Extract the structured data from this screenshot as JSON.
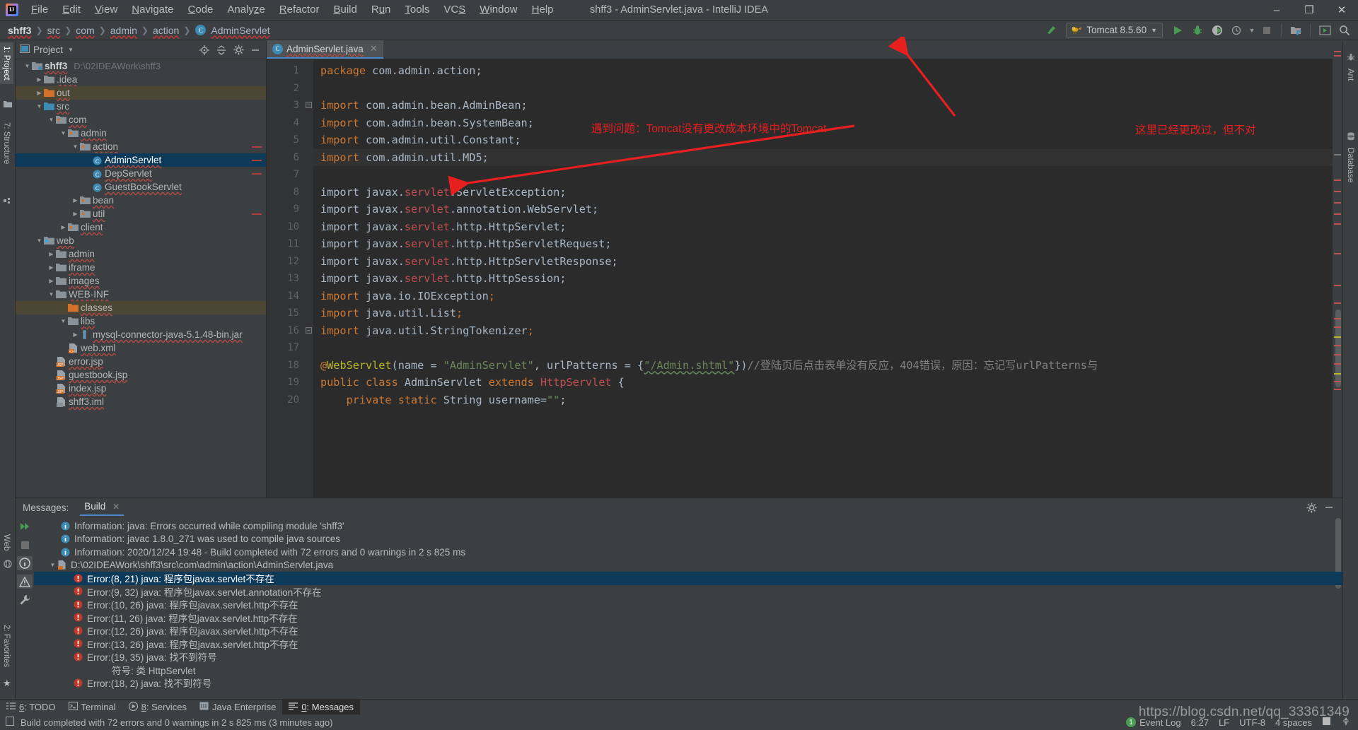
{
  "window": {
    "title": "shff3 - AdminServlet.java - IntelliJ IDEA",
    "minimize": "–",
    "maximize": "❐",
    "close": "✕"
  },
  "menu": [
    {
      "label": "File",
      "mnemonic": "F"
    },
    {
      "label": "Edit",
      "mnemonic": "E"
    },
    {
      "label": "View",
      "mnemonic": "V"
    },
    {
      "label": "Navigate",
      "mnemonic": "N"
    },
    {
      "label": "Code",
      "mnemonic": "C"
    },
    {
      "label": "Analyze",
      "mnemonic": "z"
    },
    {
      "label": "Refactor",
      "mnemonic": "R"
    },
    {
      "label": "Build",
      "mnemonic": "B"
    },
    {
      "label": "Run",
      "mnemonic": "u"
    },
    {
      "label": "Tools",
      "mnemonic": "T"
    },
    {
      "label": "VCS",
      "mnemonic": "S"
    },
    {
      "label": "Window",
      "mnemonic": "W"
    },
    {
      "label": "Help",
      "mnemonic": "H"
    }
  ],
  "breadcrumb": [
    "shff3",
    "src",
    "com",
    "admin",
    "action",
    "AdminServlet"
  ],
  "toolbar": {
    "run_config": "Tomcat 8.5.60",
    "run_icon": "run-icon",
    "debug_icon": "debug-icon",
    "coverage_icon": "coverage-icon",
    "profile_icon": "profile-icon",
    "stop_icon": "stop-icon",
    "update_icon": "update-app-icon",
    "browser_icon": "open-browser-icon",
    "search_icon": "search-everywhere-icon",
    "build_icon": "make-project-icon"
  },
  "left_tabs": [
    {
      "label": "1: Project",
      "mnemonic": "1",
      "selected": true,
      "icon": "project-icon"
    },
    {
      "label": "7: Structure",
      "mnemonic": "7",
      "selected": false,
      "icon": "structure-icon"
    },
    {
      "label": "Web",
      "selected": false,
      "icon": "web-icon"
    },
    {
      "label": "2: Favorites",
      "mnemonic": "2",
      "selected": false,
      "icon": "star-icon"
    }
  ],
  "right_tabs": [
    {
      "label": "Ant",
      "icon": "ant-icon"
    },
    {
      "label": "Database",
      "icon": "database-icon"
    }
  ],
  "project_panel": {
    "title": "Project",
    "actions": [
      "locate-icon",
      "collapse-all-icon",
      "settings-icon",
      "hide-icon"
    ],
    "tree": [
      {
        "depth": 0,
        "label": "shff3",
        "path": "D:\\02IDEAWork\\shff3",
        "icon": "module-folder",
        "arrow": "down",
        "bold": true,
        "state": "normal",
        "tick": false
      },
      {
        "depth": 1,
        "label": ".idea",
        "icon": "folder",
        "arrow": "right",
        "state": "normal",
        "tick": false
      },
      {
        "depth": 1,
        "label": "out",
        "icon": "folder-orange",
        "arrow": "right",
        "state": "amber",
        "tick": false
      },
      {
        "depth": 1,
        "label": "src",
        "icon": "folder-blue",
        "arrow": "down",
        "state": "normal",
        "tick": false
      },
      {
        "depth": 2,
        "label": "com",
        "icon": "package",
        "arrow": "down",
        "state": "normal",
        "tick": false
      },
      {
        "depth": 3,
        "label": "admin",
        "icon": "package",
        "arrow": "down",
        "state": "normal",
        "tick": false
      },
      {
        "depth": 4,
        "label": "action",
        "icon": "package",
        "arrow": "down",
        "state": "normal",
        "tick": true
      },
      {
        "depth": 5,
        "label": "AdminServlet",
        "icon": "java-class",
        "arrow": "none",
        "state": "selected",
        "tick": true
      },
      {
        "depth": 5,
        "label": "DepServlet",
        "icon": "java-class",
        "arrow": "none",
        "state": "normal",
        "tick": true
      },
      {
        "depth": 5,
        "label": "GuestBookServlet",
        "icon": "java-class",
        "arrow": "none",
        "state": "normal",
        "tick": false
      },
      {
        "depth": 4,
        "label": "bean",
        "icon": "package",
        "arrow": "right",
        "state": "normal",
        "tick": false
      },
      {
        "depth": 4,
        "label": "util",
        "icon": "package",
        "arrow": "right",
        "state": "normal",
        "tick": true
      },
      {
        "depth": 3,
        "label": "client",
        "icon": "package",
        "arrow": "right",
        "state": "normal",
        "tick": false
      },
      {
        "depth": 1,
        "label": "web",
        "icon": "web-folder",
        "arrow": "down",
        "state": "normal",
        "tick": false
      },
      {
        "depth": 2,
        "label": "admin",
        "icon": "folder",
        "arrow": "right",
        "state": "normal",
        "tick": false
      },
      {
        "depth": 2,
        "label": "iframe",
        "icon": "folder",
        "arrow": "right",
        "state": "normal",
        "tick": false
      },
      {
        "depth": 2,
        "label": "images",
        "icon": "folder",
        "arrow": "right",
        "state": "normal",
        "tick": false
      },
      {
        "depth": 2,
        "label": "WEB-INF",
        "icon": "folder",
        "arrow": "down",
        "state": "normal",
        "tick": false
      },
      {
        "depth": 3,
        "label": "classes",
        "icon": "folder-orange",
        "arrow": "none",
        "state": "amber",
        "tick": false
      },
      {
        "depth": 3,
        "label": "libs",
        "icon": "folder",
        "arrow": "down",
        "state": "normal",
        "tick": false
      },
      {
        "depth": 4,
        "label": "mysql-connector-java-5.1.48-bin.jar",
        "icon": "jar",
        "arrow": "right",
        "state": "normal",
        "tick": false
      },
      {
        "depth": 3,
        "label": "web.xml",
        "icon": "xml-file",
        "arrow": "none",
        "state": "normal",
        "tick": false
      },
      {
        "depth": 2,
        "label": "error.jsp",
        "icon": "jsp-file",
        "arrow": "none",
        "state": "normal",
        "tick": false
      },
      {
        "depth": 2,
        "label": "guestbook.jsp",
        "icon": "jsp-file",
        "arrow": "none",
        "state": "normal",
        "tick": false
      },
      {
        "depth": 2,
        "label": "index.jsp",
        "icon": "jsp-file",
        "arrow": "none",
        "state": "normal",
        "tick": false
      },
      {
        "depth": 2,
        "label": "shff3.iml",
        "icon": "iml-file",
        "arrow": "none",
        "state": "normal",
        "tick": false
      }
    ]
  },
  "editor": {
    "tab": {
      "label": "AdminServlet.java",
      "icon": "java-class",
      "close": "✕"
    },
    "lines": [
      {
        "n": 1,
        "tokens": [
          {
            "t": "package ",
            "c": "kw"
          },
          {
            "t": "com.admin.action;",
            "c": ""
          }
        ]
      },
      {
        "n": 2,
        "tokens": []
      },
      {
        "n": 3,
        "fold": true,
        "tokens": [
          {
            "t": "import ",
            "c": "kw"
          },
          {
            "t": "com.admin.bean.AdminBean;",
            "c": ""
          }
        ]
      },
      {
        "n": 4,
        "tokens": [
          {
            "t": "import ",
            "c": "kw"
          },
          {
            "t": "com.admin.bean.SystemBean;",
            "c": ""
          }
        ]
      },
      {
        "n": 5,
        "tokens": [
          {
            "t": "import ",
            "c": "kw"
          },
          {
            "t": "com.admin.util.Constant;",
            "c": ""
          }
        ]
      },
      {
        "n": 6,
        "hl": true,
        "tokens": [
          {
            "t": "import ",
            "c": "kw"
          },
          {
            "t": "com.admin.util.MD5;",
            "c": ""
          }
        ]
      },
      {
        "n": 7,
        "tokens": []
      },
      {
        "n": 8,
        "tokens": [
          {
            "t": "import javax.",
            "c": ""
          },
          {
            "t": "servlet",
            "c": "err"
          },
          {
            "t": ".ServletException;",
            "c": ""
          }
        ]
      },
      {
        "n": 9,
        "tokens": [
          {
            "t": "import javax.",
            "c": ""
          },
          {
            "t": "servlet",
            "c": "err"
          },
          {
            "t": ".annotation.WebServlet;",
            "c": ""
          }
        ]
      },
      {
        "n": 10,
        "tokens": [
          {
            "t": "import javax.",
            "c": ""
          },
          {
            "t": "servlet",
            "c": "err"
          },
          {
            "t": ".http.HttpServlet;",
            "c": ""
          }
        ]
      },
      {
        "n": 11,
        "tokens": [
          {
            "t": "import javax.",
            "c": ""
          },
          {
            "t": "servlet",
            "c": "err"
          },
          {
            "t": ".http.HttpServletRequest;",
            "c": ""
          }
        ]
      },
      {
        "n": 12,
        "tokens": [
          {
            "t": "import javax.",
            "c": ""
          },
          {
            "t": "servlet",
            "c": "err"
          },
          {
            "t": ".http.HttpServletResponse;",
            "c": ""
          }
        ]
      },
      {
        "n": 13,
        "tokens": [
          {
            "t": "import javax.",
            "c": ""
          },
          {
            "t": "servlet",
            "c": "err"
          },
          {
            "t": ".http.HttpSession;",
            "c": ""
          }
        ]
      },
      {
        "n": 14,
        "tokens": [
          {
            "t": "import ",
            "c": "kw"
          },
          {
            "t": "java.io.IOException",
            "c": ""
          },
          {
            "t": ";",
            "c": "kw"
          }
        ]
      },
      {
        "n": 15,
        "tokens": [
          {
            "t": "import ",
            "c": "kw"
          },
          {
            "t": "java.util.List",
            "c": ""
          },
          {
            "t": ";",
            "c": "kw"
          }
        ]
      },
      {
        "n": 16,
        "fold": true,
        "tokens": [
          {
            "t": "import ",
            "c": "kw"
          },
          {
            "t": "java.util.StringTokenizer",
            "c": ""
          },
          {
            "t": ";",
            "c": "kw"
          }
        ]
      },
      {
        "n": 17,
        "tokens": []
      },
      {
        "n": 18,
        "tokens": [
          {
            "t": "@",
            "c": "kw"
          },
          {
            "t": "WebServlet",
            "c": "ann"
          },
          {
            "t": "(name = ",
            "c": ""
          },
          {
            "t": "\"AdminServlet\"",
            "c": "str"
          },
          {
            "t": ", urlPatterns = {",
            "c": ""
          },
          {
            "t": "\"/Admin.shtml\"",
            "c": "str wavy"
          },
          {
            "t": "})",
            "c": ""
          },
          {
            "t": "//登陆页后点击表单没有反应，404错误，原因：忘记写urlPatterns与",
            "c": "cmt"
          }
        ]
      },
      {
        "n": 19,
        "tokens": [
          {
            "t": "public class ",
            "c": "kw"
          },
          {
            "t": "AdminServlet ",
            "c": ""
          },
          {
            "t": "extends ",
            "c": "kw"
          },
          {
            "t": "HttpServlet",
            "c": "err"
          },
          {
            "t": " {",
            "c": ""
          }
        ]
      },
      {
        "n": 20,
        "tokens": [
          {
            "t": "    private static ",
            "c": "kw"
          },
          {
            "t": "String username=",
            "c": ""
          },
          {
            "t": "\"\"",
            "c": "str"
          },
          {
            "t": ";",
            "c": ""
          }
        ]
      }
    ]
  },
  "messages_panel": {
    "label": "Messages:",
    "tab": "Build",
    "tab_close": "✕",
    "settings_icon": "settings-icon",
    "hide_icon": "hide-icon",
    "tools": [
      "rerun-icon",
      "stop-icon",
      "info-icon",
      "warning-icon",
      "wrench-icon"
    ],
    "rows": [
      {
        "indent": 1,
        "icon": "info",
        "text": "Information: java: Errors occurred while compiling module 'shff3'",
        "sel": false,
        "arrow": "none"
      },
      {
        "indent": 1,
        "icon": "info",
        "text": "Information: javac 1.8.0_271 was used to compile java sources",
        "sel": false,
        "arrow": "none"
      },
      {
        "indent": 1,
        "icon": "info",
        "text": "Information: 2020/12/24 19:48 - Build completed with 72 errors and 0 warnings in 2 s 825 ms",
        "sel": false,
        "arrow": "none"
      },
      {
        "indent": 0,
        "icon": "java-file",
        "text": "D:\\02IDEAWork\\shff3\\src\\com\\admin\\action\\AdminServlet.java",
        "sel": false,
        "arrow": "down"
      },
      {
        "indent": 2,
        "icon": "error",
        "text": "Error:(8, 21)  java: 程序包javax.servlet不存在",
        "sel": true,
        "arrow": "none"
      },
      {
        "indent": 2,
        "icon": "error",
        "text": "Error:(9, 32)  java: 程序包javax.servlet.annotation不存在",
        "sel": false,
        "arrow": "none"
      },
      {
        "indent": 2,
        "icon": "error",
        "text": "Error:(10, 26)  java: 程序包javax.servlet.http不存在",
        "sel": false,
        "arrow": "none"
      },
      {
        "indent": 2,
        "icon": "error",
        "text": "Error:(11, 26)  java: 程序包javax.servlet.http不存在",
        "sel": false,
        "arrow": "none"
      },
      {
        "indent": 2,
        "icon": "error",
        "text": "Error:(12, 26)  java: 程序包javax.servlet.http不存在",
        "sel": false,
        "arrow": "none"
      },
      {
        "indent": 2,
        "icon": "error",
        "text": "Error:(13, 26)  java: 程序包javax.servlet.http不存在",
        "sel": false,
        "arrow": "none"
      },
      {
        "indent": 2,
        "icon": "error",
        "text": "Error:(19, 35)  java: 找不到符号",
        "sel": false,
        "arrow": "none"
      },
      {
        "indent": 5,
        "icon": "none",
        "text": "符号: 类 HttpServlet",
        "sel": false,
        "arrow": "none"
      },
      {
        "indent": 2,
        "icon": "error",
        "text": "Error:(18, 2)  java: 找不到符号",
        "sel": false,
        "arrow": "none"
      }
    ]
  },
  "bottom_tabs": [
    {
      "label": "6: TODO",
      "mnemonic": "6",
      "icon": "todo-icon",
      "selected": false
    },
    {
      "label": "Terminal",
      "icon": "terminal-icon",
      "selected": false
    },
    {
      "label": "8: Services",
      "mnemonic": "8",
      "icon": "services-icon",
      "selected": false
    },
    {
      "label": "Java Enterprise",
      "icon": "java-ee-icon",
      "selected": false
    },
    {
      "label": "0: Messages",
      "mnemonic": "0",
      "icon": "messages-icon",
      "selected": true
    }
  ],
  "statusbar": {
    "message": "Build completed with 72 errors and 0 warnings in 2 s 825 ms (3 minutes ago)",
    "caret": "6:27",
    "line_sep": "LF",
    "encoding": "UTF-8",
    "indent": "4 spaces",
    "event_log": "Event Log",
    "event_count": "1",
    "lock_icon": "read-only-icon",
    "inspector_icon": "inspector-icon"
  },
  "annotations": [
    {
      "id": "ann-tomcat-env",
      "text": "遇到问题：Tomcat没有更改成本环境中的Tomcat"
    },
    {
      "id": "ann-changed",
      "text": "这里已经更改过，但不对"
    }
  ],
  "watermark": "https://blog.csdn.net/qq_33361349",
  "colors": {
    "accent": "#4a88c7",
    "error": "#c05050",
    "annotation_red": "#e81f1f",
    "selection": "#0d3a58",
    "amber_row": "#4c4635",
    "keyword": "#cc7832",
    "string": "#6a8759"
  }
}
